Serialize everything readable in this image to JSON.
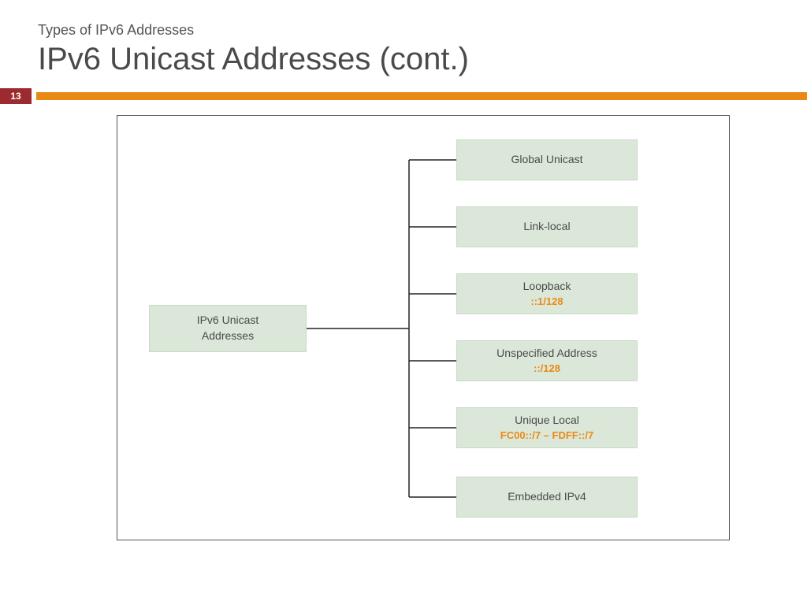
{
  "header": {
    "eyebrow": "Types of IPv6 Addresses",
    "title": "IPv6 Unicast Addresses (cont.)",
    "slide_number": "13"
  },
  "diagram": {
    "root": {
      "label": "IPv6 Unicast\nAddresses"
    },
    "children": [
      {
        "label": "Global Unicast",
        "sub": ""
      },
      {
        "label": "Link-local",
        "sub": ""
      },
      {
        "label": "Loopback",
        "sub": "::1/128"
      },
      {
        "label": "Unspecified Address",
        "sub": "::/128"
      },
      {
        "label": "Unique Local",
        "sub": "FC00::/7 – FDFF::/7"
      },
      {
        "label": "Embedded IPv4",
        "sub": ""
      }
    ]
  },
  "colors": {
    "accent_badge": "#9d2a2f",
    "accent_bar": "#e98a15",
    "box_fill": "#dbe8d9",
    "sub_text": "#e98a15"
  }
}
